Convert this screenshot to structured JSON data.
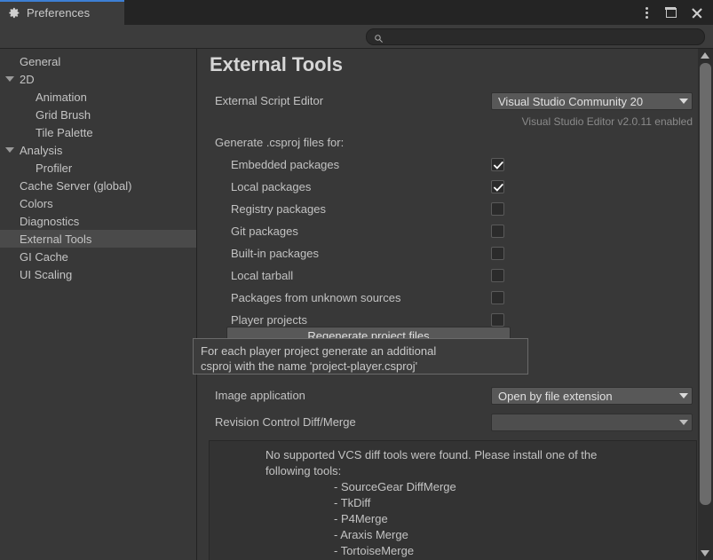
{
  "window": {
    "tab_label": "Preferences",
    "gear_icon": "gear-icon",
    "menu_icon": "kebab-menu-icon",
    "maximize_icon": "maximize-icon",
    "close_icon": "close-icon",
    "accent_color": "#3d7fd4",
    "background_color": "#383838"
  },
  "search": {
    "value": "",
    "placeholder": "",
    "icon": "search-icon"
  },
  "sidebar": {
    "items": [
      {
        "label": "General",
        "level": 0,
        "expandable": false,
        "selected": false
      },
      {
        "label": "2D",
        "level": 0,
        "expandable": true,
        "selected": false
      },
      {
        "label": "Animation",
        "level": 1,
        "expandable": false,
        "selected": false
      },
      {
        "label": "Grid Brush",
        "level": 1,
        "expandable": false,
        "selected": false
      },
      {
        "label": "Tile Palette",
        "level": 1,
        "expandable": false,
        "selected": false
      },
      {
        "label": "Analysis",
        "level": 0,
        "expandable": true,
        "selected": false
      },
      {
        "label": "Profiler",
        "level": 1,
        "expandable": false,
        "selected": false
      },
      {
        "label": "Cache Server (global)",
        "level": 0,
        "expandable": false,
        "selected": false
      },
      {
        "label": "Colors",
        "level": 0,
        "expandable": false,
        "selected": false
      },
      {
        "label": "Diagnostics",
        "level": 0,
        "expandable": false,
        "selected": false
      },
      {
        "label": "External Tools",
        "level": 0,
        "expandable": false,
        "selected": true
      },
      {
        "label": "GI Cache",
        "level": 0,
        "expandable": false,
        "selected": false
      },
      {
        "label": "UI Scaling",
        "level": 0,
        "expandable": false,
        "selected": false
      }
    ]
  },
  "main": {
    "title": "External Tools",
    "script_editor": {
      "label": "External Script Editor",
      "value": "Visual Studio Community 20",
      "note": "Visual Studio Editor v2.0.11 enabled"
    },
    "csproj": {
      "heading": "Generate .csproj files for:",
      "options": [
        {
          "label": "Embedded packages",
          "checked": true
        },
        {
          "label": "Local packages",
          "checked": true
        },
        {
          "label": "Registry packages",
          "checked": false
        },
        {
          "label": "Git packages",
          "checked": false
        },
        {
          "label": "Built-in packages",
          "checked": false
        },
        {
          "label": "Local tarball",
          "checked": false
        },
        {
          "label": "Packages from unknown sources",
          "checked": false
        },
        {
          "label": "Player projects",
          "checked": false
        }
      ],
      "regenerate_button": "Regenerate project files"
    },
    "image_application": {
      "label": "Image application",
      "value": "Open by file extension"
    },
    "revision_control": {
      "label": "Revision Control Diff/Merge",
      "value": ""
    },
    "vcs_info": {
      "line1": "No supported VCS diff tools were found. Please install one of the",
      "line2": "following tools:",
      "tools": [
        "- SourceGear DiffMerge",
        "- TkDiff",
        "- P4Merge",
        "- Araxis Merge",
        "- TortoiseMerge"
      ]
    }
  },
  "tooltip": {
    "line1": "For each player project generate an additional",
    "line2": "csproj with the name 'project-player.csproj'"
  },
  "scrollbar": {
    "up_icon": "scroll-up-arrow-icon",
    "down_icon": "scroll-down-arrow-icon"
  }
}
